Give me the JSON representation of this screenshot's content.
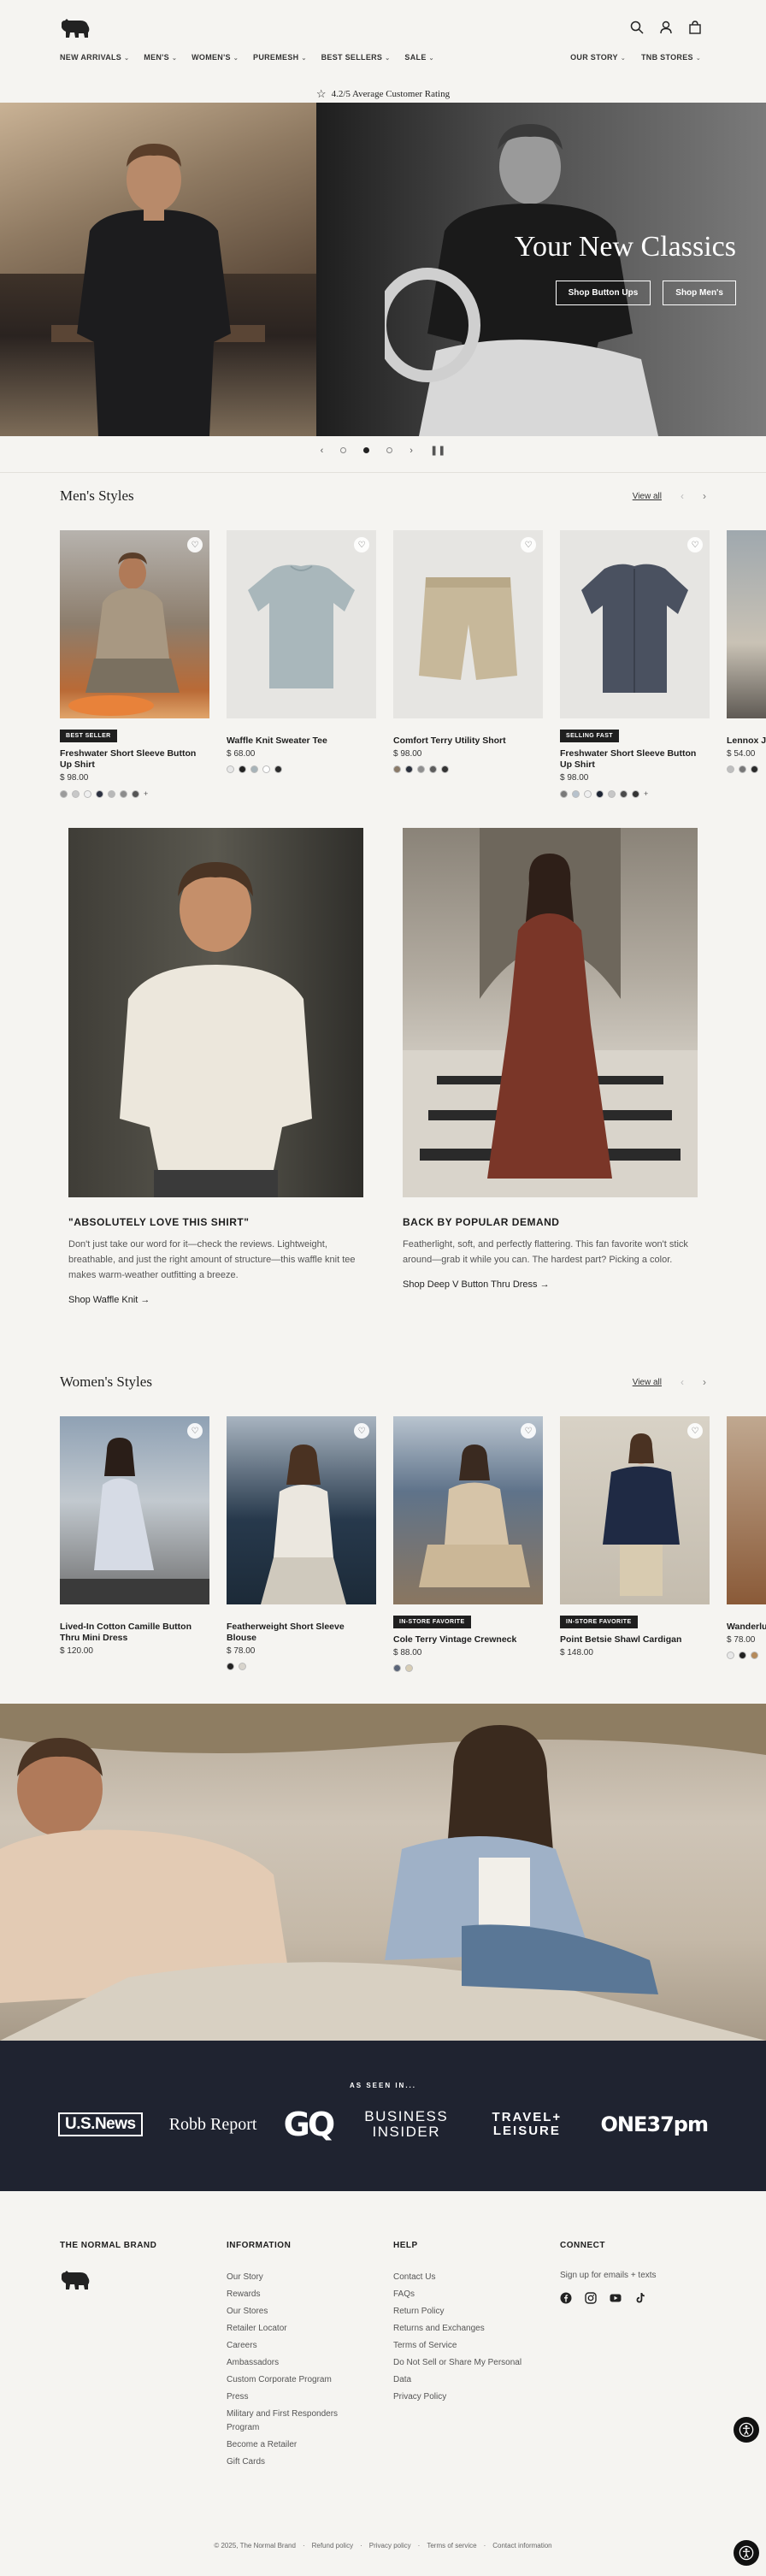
{
  "header": {
    "nav_left": [
      "NEW ARRIVALS",
      "MEN'S",
      "WOMEN'S",
      "PUREMESH",
      "BEST SELLERS",
      "SALE"
    ],
    "nav_right": [
      "OUR STORY",
      "TNB STORES"
    ]
  },
  "rating": {
    "text": "4.2/5 Average Customer Rating"
  },
  "hero": {
    "title": "Your New Classics",
    "btn_button_ups": "Shop Button Ups",
    "btn_mens": "Shop Men's"
  },
  "mens": {
    "title": "Men's Styles",
    "view_all": "View all",
    "products": [
      {
        "badge": "BEST SELLER",
        "name": "Freshwater Short Sleeve Button Up Shirt",
        "price": "$ 98.00",
        "swatches": [
          "#9b9b9b",
          "#c8c8c8",
          "#f0f0f0",
          "#2b3040",
          "#b8b8b8",
          "#8c8c8c",
          "#555555"
        ],
        "more": "+"
      },
      {
        "badge": "",
        "name": "Waffle Knit Sweater Tee",
        "price": "$ 68.00",
        "swatches": [
          "#e8e8e8",
          "#222222",
          "#a7b3b8",
          "#ffffff",
          "#2c2c2c"
        ],
        "more": ""
      },
      {
        "badge": "",
        "name": "Comfort Terry Utility Short",
        "price": "$ 98.00",
        "swatches": [
          "#8a7a68",
          "#2a2f3b",
          "#8f8f8f",
          "#5c5c5c",
          "#333333"
        ],
        "more": ""
      },
      {
        "badge": "SELLING FAST",
        "name": "Freshwater Short Sleeve Button Up Shirt",
        "price": "$ 98.00",
        "swatches": [
          "#7a7a7a",
          "#b7c2cc",
          "#f0f0f0",
          "#1c2433",
          "#c7c7c7",
          "#4a4a4a",
          "#333333"
        ],
        "more": "+"
      },
      {
        "badge": "",
        "name": "Lennox Je",
        "price": "$ 54.00",
        "swatches": [
          "#bfbfbf",
          "#777777",
          "#2a2a2a"
        ],
        "more": ""
      }
    ]
  },
  "features": [
    {
      "heading": "\"ABSOLUTELY LOVE THIS SHIRT\"",
      "body": "Don't just take our word for it—check the reviews. Lightweight, breathable, and just the right amount of structure—this waffle knit tee makes warm-weather outfitting a breeze.",
      "link": "Shop Waffle Knit"
    },
    {
      "heading": "BACK BY POPULAR DEMAND",
      "body": "Featherlight, soft, and perfectly flattering. This fan favorite won't stick around—grab it while you can. The hardest part? Picking a color.",
      "link": "Shop Deep V Button Thru Dress"
    }
  ],
  "womens": {
    "title": "Women's Styles",
    "view_all": "View all",
    "products": [
      {
        "badge": "",
        "name": "Lived-In Cotton Camille Button Thru Mini Dress",
        "price": "$ 120.00",
        "swatches": []
      },
      {
        "badge": "",
        "name": "Featherweight Short Sleeve Blouse",
        "price": "$ 78.00",
        "swatches": [
          "#222222",
          "#d8d4cc"
        ]
      },
      {
        "badge": "IN-STORE FAVORITE",
        "name": "Cole Terry Vintage Crewneck",
        "price": "$ 88.00",
        "swatches": [
          "#5a6478",
          "#d8cdb4"
        ]
      },
      {
        "badge": "IN-STORE FAVORITE",
        "name": "Point Betsie Shawl Cardigan",
        "price": "$ 148.00",
        "swatches": []
      },
      {
        "badge": "",
        "name": "Wanderlu",
        "price": "$ 78.00",
        "swatches": [
          "#e8e8e8",
          "#222222",
          "#b58a5a"
        ]
      }
    ]
  },
  "press": {
    "label": "AS SEEN IN...",
    "logos": [
      "U.S.News",
      "Robb Report",
      "GQ",
      "BUSINESS INSIDER",
      "TRAVEL+ LEISURE",
      "ONE37pm"
    ]
  },
  "footer": {
    "brand": "THE NORMAL BRAND",
    "info_title": "INFORMATION",
    "info_links": [
      "Our Story",
      "Rewards",
      "Our Stores",
      "Retailer Locator",
      "Careers",
      "Ambassadors",
      "Custom Corporate Program",
      "Press",
      "Military and First Responders Program",
      "Become a Retailer",
      "Gift Cards"
    ],
    "help_title": "HELP",
    "help_links": [
      "Contact Us",
      "FAQs",
      "Return Policy",
      "Returns and Exchanges",
      "Terms of Service",
      "Do Not Sell or Share My Personal Data",
      "Privacy Policy"
    ],
    "connect_title": "CONNECT",
    "connect_text": "Sign up for emails + texts",
    "copyright": [
      "© 2025, The Normal Brand",
      "Refund policy",
      "Privacy policy",
      "Terms of service",
      "Contact information"
    ]
  },
  "colors": {
    "press_bg": "#1f2330",
    "page_bg": "#f5f4f1",
    "badge_bg": "#1f1f1f"
  }
}
